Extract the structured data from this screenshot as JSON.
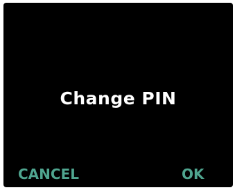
{
  "screen": {
    "title": "Change PIN"
  },
  "softkeys": {
    "cancel_label": "CANCEL",
    "ok_label": "OK"
  },
  "colors": {
    "background": "#000000",
    "title_text": "#ffffff",
    "softkey_text": "#4fa58f"
  }
}
